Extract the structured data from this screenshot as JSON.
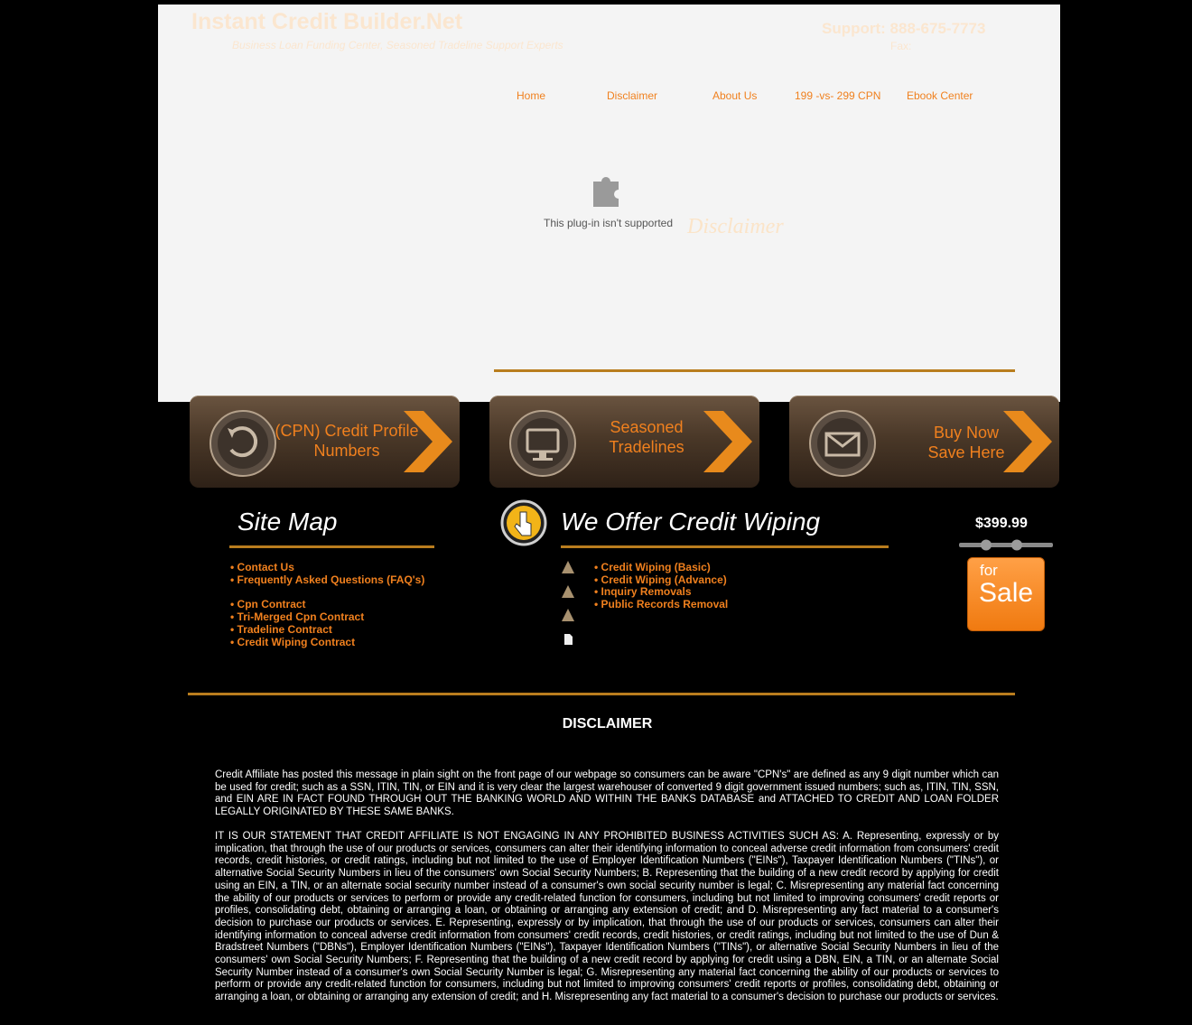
{
  "header": {
    "brand": "Instant Credit Builder.Net",
    "tagline": "Business Loan Funding Center, Seasoned Tradeline Support Experts",
    "support": "Support: 888-675-7773",
    "fax": "Fax:"
  },
  "nav": [
    "Home",
    "Disclaimer",
    "About Us",
    "199 -vs- 299 CPN",
    "Ebook Center"
  ],
  "plugin": {
    "message": "This plug-in isn't supported",
    "ghost_title": "Disclaimer"
  },
  "banners": [
    {
      "line1": "(CPN) Credit Profile",
      "line2": "Numbers",
      "icon": "refresh-icon"
    },
    {
      "line1": "Seasoned",
      "line2": "Tradelines",
      "icon": "monitor-icon"
    },
    {
      "line1": "Buy Now",
      "line2": "Save Here",
      "icon": "envelope-icon"
    }
  ],
  "sitemap": {
    "title": "Site Map",
    "links_a": [
      "• Contact Us",
      "• Frequently Asked Questions (FAQ's)"
    ],
    "links_b": [
      "• Cpn Contract",
      "• Tri-Merged Cpn Contract",
      "• Tradeline Contract",
      "• Credit Wiping Contract"
    ]
  },
  "offer": {
    "title": "We Offer Credit Wiping",
    "links": [
      "• Credit Wiping (Basic)",
      "• Credit Wiping (Advance)",
      "• Inquiry Removals",
      "• Public Records Removal"
    ]
  },
  "sale": {
    "price": "$399.99",
    "for": "for",
    "label": "Sale"
  },
  "disclaimer": {
    "title": "DISCLAIMER",
    "para1": "Credit Affiliate has posted this message in plain sight on the front page of our webpage so consumers can be aware \"CPN's\" are defined as any 9 digit number which can be used for credit; such as a SSN, ITIN, TIN, or EIN and it is very clear the largest warehouser of converted 9 digit government issued numbers; such as, ITIN, TIN, SSN, and EIN ARE IN FACT FOUND THROUGH OUT THE BANKING WORLD AND WITHIN THE BANKS DATABASE and ATTACHED TO CREDIT AND LOAN FOLDER LEGALLY ORIGINATED BY THESE SAME BANKS.",
    "para2": "IT IS OUR STATEMENT THAT CREDIT AFFILIATE IS NOT ENGAGING IN ANY PROHIBITED BUSINESS ACTIVITIES SUCH AS: A. Representing, expressly or by implication, that through the use of our products or services, consumers can alter their identifying information to conceal adverse credit information from consumers' credit records, credit histories, or credit ratings, including but not limited to the use of Employer Identification Numbers (\"EINs\"), Taxpayer Identification Numbers (\"TINs\"), or alternative Social Security Numbers in lieu of the consumers' own Social Security Numbers; B. Representing that the building of a new credit record by applying for credit using an EIN, a TIN, or an alternate social security number instead of a consumer's own social security number is legal; C. Misrepresenting any material fact concerning the ability of our products or services to perform or provide any credit-related function for consumers, including but not limited to improving consumers' credit reports or profiles, consolidating debt, obtaining or arranging a loan, or obtaining or arranging any extension of credit; and D. Misrepresenting any fact material to a consumer's decision to purchase our products or services. E. Representing, expressly or by implication, that through the use of our products or services, consumers can alter their identifying information to conceal adverse credit information from consumers' credit records, credit histories, or credit ratings, including but not limited to the use of Dun & Bradstreet Numbers (\"DBNs\"), Employer Identification Numbers (\"EINs\"), Taxpayer Identification Numbers (\"TINs\"), or alternative Social Security Numbers in lieu of the consumers' own Social Security Numbers; F. Representing that the building of a new credit record by applying for credit using a DBN, EIN, a TIN, or an alternate Social Security Number instead of a consumer's own Social Security Number is legal; G. Misrepresenting any material fact concerning the ability of our products or services to perform or provide any credit-related function for consumers, including but not limited to improving consumers' credit reports or profiles, consolidating debt, obtaining or arranging a loan, or obtaining or arranging any extension of credit; and H. Misrepresenting any fact material to a consumer's decision to purchase our products or services."
  },
  "colors": {
    "accent": "#f0801e",
    "gold": "#b97d1e",
    "background": "#000000",
    "panel": "#f4f4f4"
  }
}
